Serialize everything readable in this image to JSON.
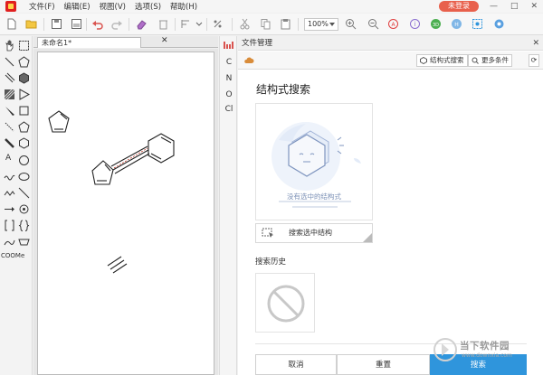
{
  "menu": {
    "items": [
      "文件(F)",
      "编辑(E)",
      "视图(V)",
      "选项(S)",
      "帮助(H)"
    ],
    "login_label": "未登录",
    "window_buttons": [
      "—",
      "□",
      "✕"
    ]
  },
  "toolbar": {
    "zoom": "100%",
    "icons": [
      "new-file-icon",
      "open-folder-icon",
      "save-icon",
      "save-all-icon",
      "undo-icon",
      "redo-icon",
      "eraser-icon",
      "delete-icon",
      "align-icon",
      "flip-icon",
      "cut-icon",
      "copy-icon",
      "paste-icon",
      "zoom-in-icon",
      "zoom-out-icon",
      "zoom-fit-icon",
      "formula-icon",
      "info-icon",
      "3d-icon",
      "h-icon",
      "select-icon",
      "settings-icon"
    ]
  },
  "palette": {
    "text_tool": "A",
    "coome_label": "COOMe"
  },
  "document": {
    "tab_title": "未命名1*",
    "close": "✕"
  },
  "elements": [
    "C",
    "N",
    "O",
    "Cl"
  ],
  "panel": {
    "header_title": "文件管理",
    "header_close": "✕",
    "tab_structure_search": "结构式搜索",
    "tab_more_conditions": "更多条件",
    "title": "结构式搜索",
    "empty_message": "没有选中的结构式",
    "search_selected_label": "搜索选中结构",
    "history_label": "搜索历史",
    "cancel_label": "取消",
    "reset_label": "重置",
    "search_label": "搜索"
  },
  "watermark": {
    "text": "当下软件园",
    "sub": "www.downxia.com"
  },
  "colors": {
    "accent_blue": "#2f95dc",
    "login_red": "#e8604c",
    "brand_red": "#e02020"
  }
}
